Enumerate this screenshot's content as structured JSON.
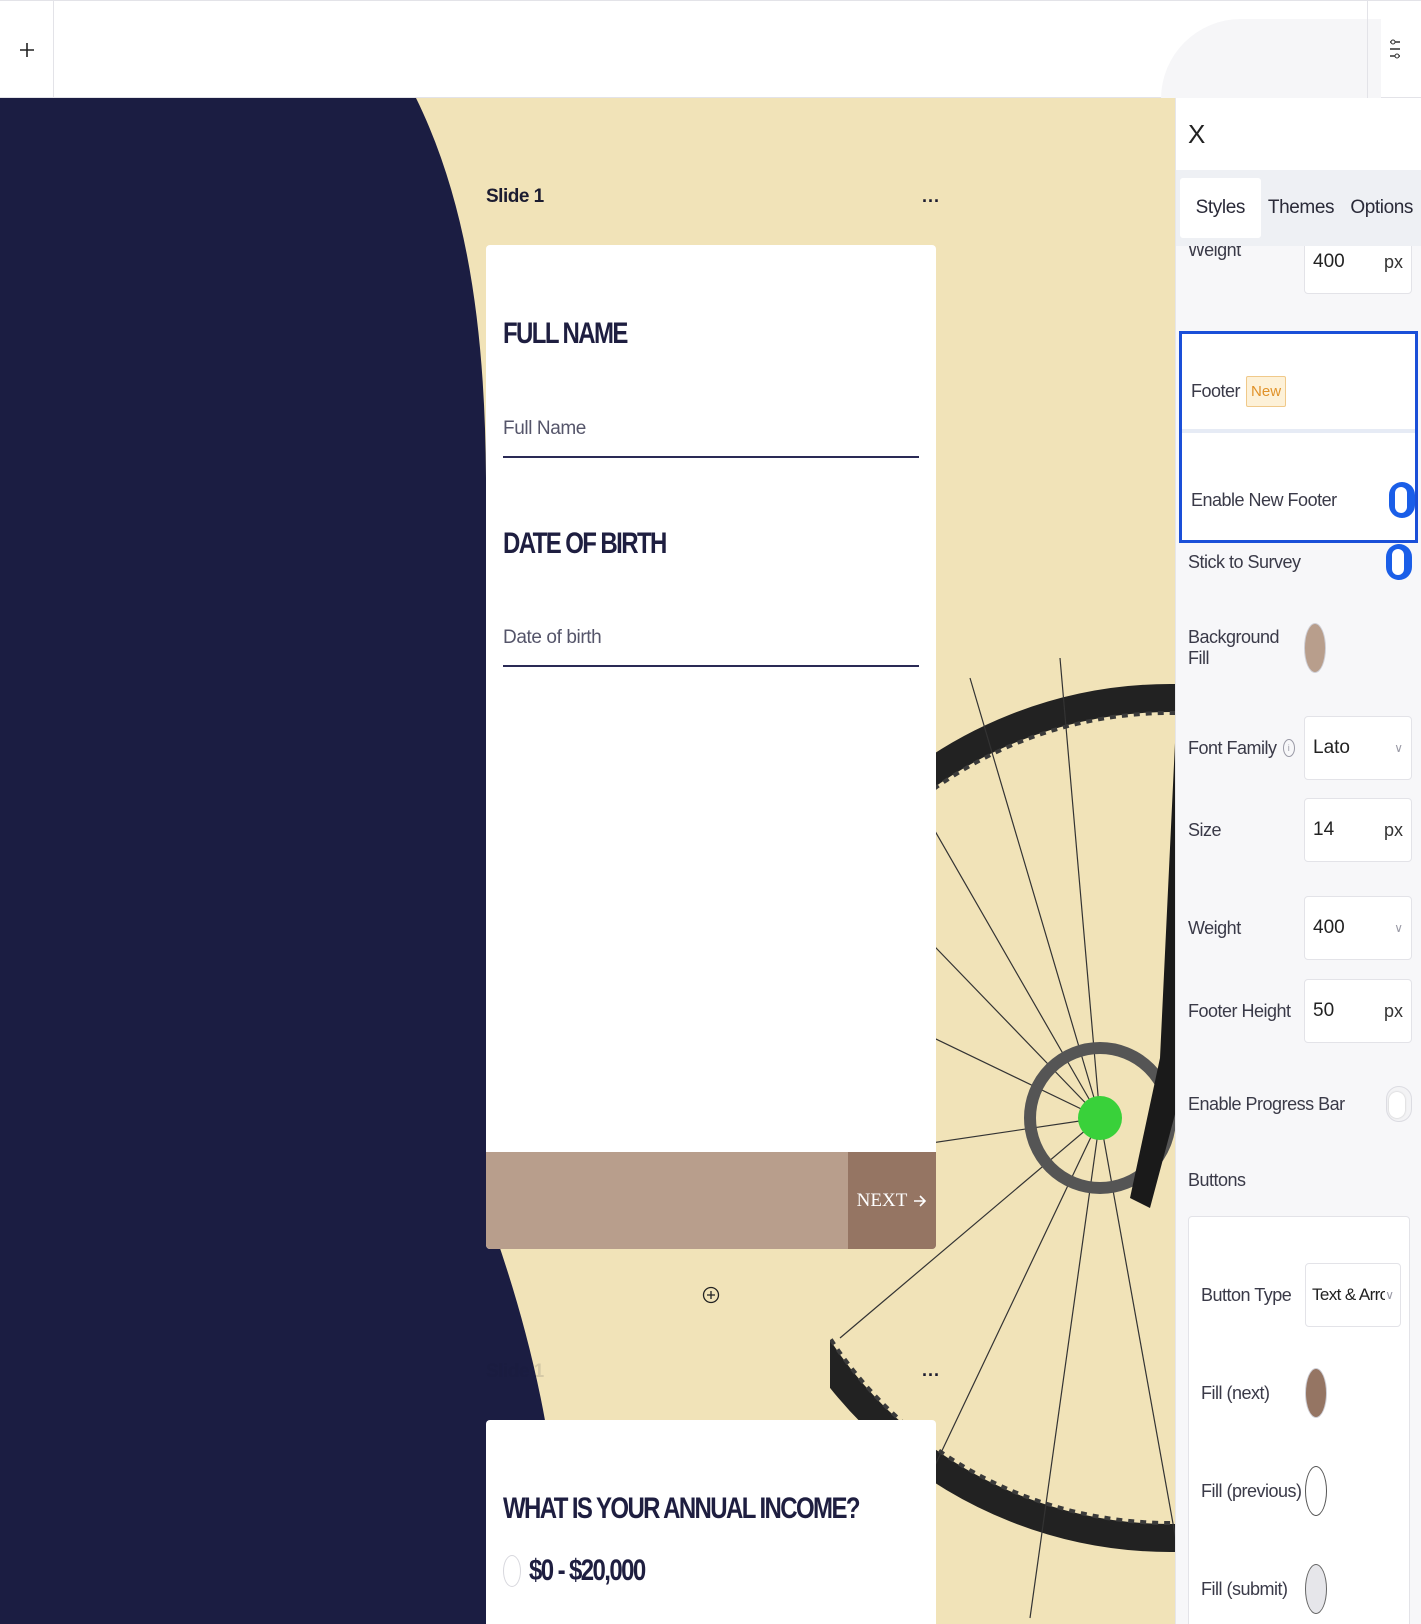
{
  "canvas": {
    "slide1": {
      "label": "Slide 1",
      "more": "...",
      "questions": [
        {
          "title": "FULL NAME",
          "placeholder": "Full Name"
        },
        {
          "title": "DATE OF BIRTH",
          "placeholder": "Date of birth"
        }
      ],
      "next_label": "NEXT"
    },
    "slide2": {
      "label": "Slide 1",
      "more": "...",
      "title": "WHAT IS YOUR ANNUAL INCOME?",
      "option1": "$0 - $20,000"
    }
  },
  "panel": {
    "close": "X",
    "tabs": [
      "Styles",
      "Themes",
      "Options"
    ],
    "weight_top": {
      "label": "Weight",
      "value": "400",
      "unit": "px"
    },
    "footer": {
      "label": "Footer",
      "badge": "New"
    },
    "enable_new_footer": {
      "label": "Enable New Footer",
      "on": true
    },
    "stick_to_survey": {
      "label": "Stick to Survey",
      "on": true
    },
    "background_fill": {
      "label": "Background Fill",
      "color": "#b89e8c"
    },
    "font_family": {
      "label": "Font Family",
      "value": "Lato"
    },
    "size": {
      "label": "Size",
      "value": "14",
      "unit": "px"
    },
    "weight": {
      "label": "Weight",
      "value": "400"
    },
    "footer_height": {
      "label": "Footer Height",
      "value": "50",
      "unit": "px"
    },
    "enable_progress_bar": {
      "label": "Enable Progress Bar",
      "on": false
    },
    "buttons": {
      "label": "Buttons",
      "button_type": {
        "label": "Button Type",
        "value": "Text & Arrow"
      },
      "fill_next": {
        "label": "Fill (next)",
        "color": "#957563"
      },
      "fill_previous": {
        "label": "Fill (previous)",
        "color": "#ffffff"
      },
      "fill_submit": {
        "label": "Fill (submit)",
        "color": "#e6e6ea"
      }
    }
  },
  "colors": {
    "navy": "#1b1d42",
    "cream": "#f1e3b8",
    "accent_blue": "#1a5ee8"
  }
}
